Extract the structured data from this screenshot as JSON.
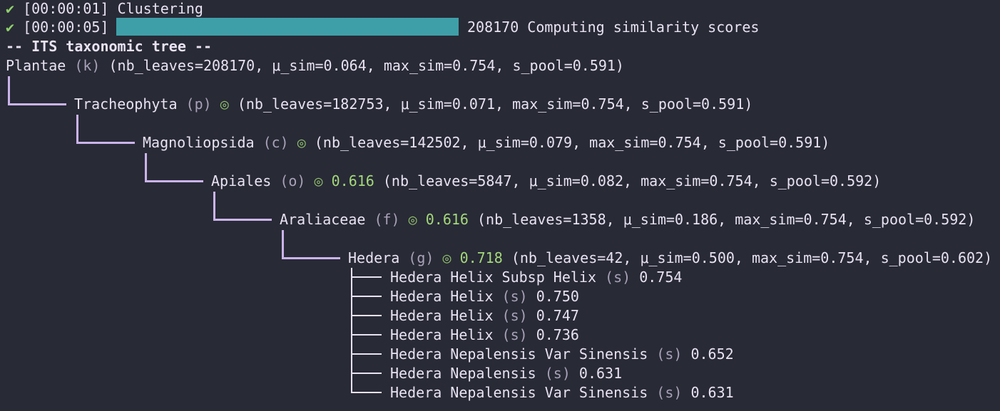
{
  "log": [
    {
      "check": "✔",
      "time": "[00:00:01]",
      "message": "Clustering"
    },
    {
      "check": "✔",
      "time": "[00:00:05]",
      "count": "208170",
      "message": "Computing similarity scores",
      "progress": 1.0
    }
  ],
  "tree_title": "-- ITS taxonomic tree --",
  "nodes": [
    {
      "name": "Plantae",
      "rank": "(k)",
      "marker": "",
      "score": "",
      "stats": "(nb_leaves=208170, μ_sim=0.064, max_sim=0.754, s_pool=0.591)"
    },
    {
      "name": "Tracheophyta",
      "rank": "(p)",
      "marker": "◎",
      "score": "",
      "stats": "(nb_leaves=182753, μ_sim=0.071, max_sim=0.754, s_pool=0.591)"
    },
    {
      "name": "Magnoliopsida",
      "rank": "(c)",
      "marker": "◎",
      "score": "",
      "stats": "(nb_leaves=142502, μ_sim=0.079, max_sim=0.754, s_pool=0.591)"
    },
    {
      "name": "Apiales",
      "rank": "(o)",
      "marker": "◎",
      "score": "0.616",
      "stats": "(nb_leaves=5847, μ_sim=0.082, max_sim=0.754, s_pool=0.592)"
    },
    {
      "name": "Araliaceae",
      "rank": "(f)",
      "marker": "◎",
      "score": "0.616",
      "stats": "(nb_leaves=1358, μ_sim=0.186, max_sim=0.754, s_pool=0.592)"
    },
    {
      "name": "Hedera",
      "rank": "(g)",
      "marker": "◎",
      "score": "0.718",
      "stats": "(nb_leaves=42, μ_sim=0.500, max_sim=0.754, s_pool=0.602)"
    }
  ],
  "leaves": [
    {
      "name": "Hedera Helix Subsp Helix",
      "rank": "(s)",
      "score": "0.754"
    },
    {
      "name": "Hedera Helix",
      "rank": "(s)",
      "score": "0.750"
    },
    {
      "name": "Hedera Helix",
      "rank": "(s)",
      "score": "0.747"
    },
    {
      "name": "Hedera Helix",
      "rank": "(s)",
      "score": "0.736"
    },
    {
      "name": "Hedera Nepalensis Var Sinensis",
      "rank": "(s)",
      "score": "0.652"
    },
    {
      "name": "Hedera Nepalensis",
      "rank": "(s)",
      "score": "0.631"
    },
    {
      "name": "Hedera Nepalensis Var Sinensis",
      "rank": "(s)",
      "score": "0.631"
    }
  ],
  "colors": {
    "background": "#282a36",
    "text": "#e8e2f2",
    "check": "#8fd16a",
    "progress_fill": "#3e9fa8",
    "connector": "#cbb3ea",
    "score": "#a4d87a"
  }
}
